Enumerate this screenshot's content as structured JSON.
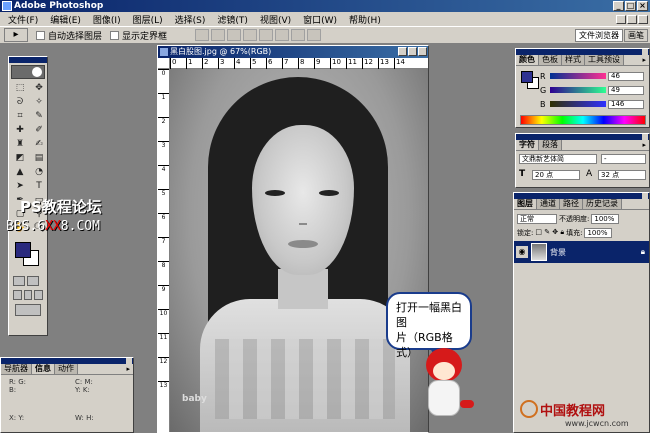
{
  "app": {
    "title": "Adobe Photoshop"
  },
  "menu": [
    "文件(F)",
    "编辑(E)",
    "图像(I)",
    "图层(L)",
    "选择(S)",
    "滤镜(T)",
    "视图(V)",
    "窗口(W)",
    "帮助(H)"
  ],
  "options": {
    "auto_select": "自动选择图层",
    "show_bounds": "显示定界框"
  },
  "palette_well": {
    "file_browser": "文件浏览器",
    "brushes": "画笔"
  },
  "watermark": {
    "line1": "PS教程论坛",
    "line2_a": "BBS.",
    "line2_b": "6",
    "line2_c": "XX",
    "line2_d": "8.COM"
  },
  "document": {
    "title": "黑白股图.jpg @ 67%(RGB)",
    "ruler_ticks": [
      "0",
      "1",
      "2",
      "3",
      "4",
      "5",
      "6",
      "7",
      "8",
      "9",
      "10",
      "11",
      "12",
      "13",
      "14"
    ],
    "logo_text": "baby"
  },
  "color_panel": {
    "tabs": [
      "颜色",
      "色板",
      "样式",
      "工具预设"
    ],
    "r_label": "R",
    "g_label": "G",
    "b_label": "B",
    "r_value": "46",
    "g_value": "49",
    "b_value": "146",
    "fg_color": "#2e3192"
  },
  "char_panel": {
    "tabs": [
      "字符",
      "段落"
    ],
    "font_family": "文鼎新艺体简",
    "font_style": "-",
    "size": "20 点",
    "leading": "32 点"
  },
  "layers_panel": {
    "tabs": [
      "图层",
      "通道",
      "路径",
      "历史记录"
    ],
    "blend_mode": "正常",
    "opacity_label": "不透明度:",
    "opacity": "100%",
    "lock_label": "锁定:",
    "fill_label": "填充:",
    "fill": "100%",
    "layer_name": "背景"
  },
  "nav_panel": {
    "tabs": [
      "导航器",
      "信息",
      "动作"
    ],
    "rgb": "R: G: B:",
    "cmyk": "C: M: Y: K:",
    "xy": "X: Y:",
    "wh": "W: H:"
  },
  "bubble": {
    "line1": "打开一幅黑白图",
    "line2": "片（RGB格式）"
  },
  "site": {
    "name": "中国教程网",
    "url": "www.jcwcn.com"
  }
}
